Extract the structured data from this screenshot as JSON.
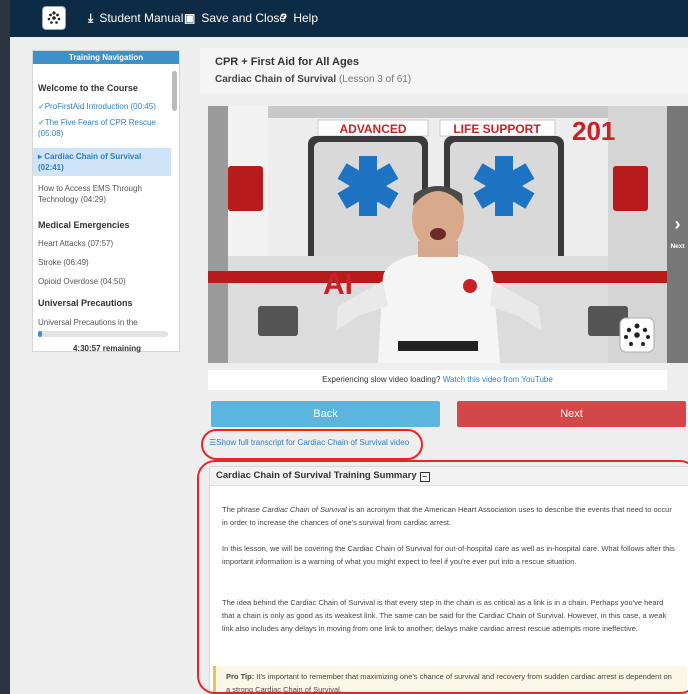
{
  "topbar": {
    "student_manual": "Student Manual",
    "save_and_close": "Save and Close",
    "help": "Help"
  },
  "sidebar": {
    "title": "Training Navigation",
    "sections": [
      {
        "title": "Welcome to the Course",
        "items": [
          {
            "label": "ProFirstAid Introduction (00:45)",
            "state": "done"
          },
          {
            "label": "The Five Fears of CPR Rescue (05:08)",
            "state": "done"
          },
          {
            "label": "Cardiac Chain of Survival (02:41)",
            "state": "active"
          },
          {
            "label": "How to Access EMS Through Technology (04:29)",
            "state": "normal"
          }
        ]
      },
      {
        "title": "Medical Emergencies",
        "items": [
          {
            "label": "Heart Attacks (07:57)",
            "state": "normal"
          },
          {
            "label": "Stroke (06:49)",
            "state": "normal"
          },
          {
            "label": "Opioid Overdose (04:50)",
            "state": "normal"
          }
        ]
      },
      {
        "title": "Universal Precautions",
        "items": [
          {
            "label": "Universal Precautions in the",
            "state": "normal"
          }
        ]
      }
    ],
    "progress": 0.03,
    "remaining": "4:30:57 remaining"
  },
  "header": {
    "course": "CPR + First Aid for All Ages",
    "lesson_title": "Cardiac Chain of Survival",
    "lesson_count": "(Lesson 3 of 61)"
  },
  "video": {
    "sign_left": "ADVANCED",
    "sign_right": "LIFE SUPPORT",
    "unit_number": "201",
    "side_text": "AI",
    "next_label": "Next"
  },
  "slow_video": {
    "text": "Experiencing slow video loading?",
    "link": "Watch this video from YouTube"
  },
  "buttons": {
    "back": "Back",
    "next": "Next"
  },
  "transcript_link": "Show full transcript for Cardiac Chain of Survival video",
  "summary": {
    "title": "Cardiac Chain of Survival Training Summary",
    "p1_pre": "The phrase ",
    "p1_em": "Cardiac Chain of Survival",
    "p1_post": " is an acronym that the American Heart Association uses to describe the events that need to occur in order to increase the chances of one's survival from cardiac arrest.",
    "p2": "In this lesson, we will be covering the Cardiac Chain of Survival for out-of-hospital care as well as in-hospital care. What follows after this important information is a warning of what you might expect to feel if you're ever put into a rescue situation.",
    "p3": "The idea behind the Cardiac Chain of Survival is that every step in the chain is as critical as a link is in a chain. Perhaps you've heard that a chain is only as good as its weakest link. The same can be said for the Cardiac Chain of Survival. However, in this case, a weak link also includes any delays in moving from one link to another; delays make cardiac arrest rescue attempts more ineffective.",
    "protip_label": "Pro Tip:",
    "protip": "It's important to remember that maximizing one's chance of survival and recovery from sudden cardiac arrest is dependent on a strong Cardiac Chain of Survival."
  }
}
